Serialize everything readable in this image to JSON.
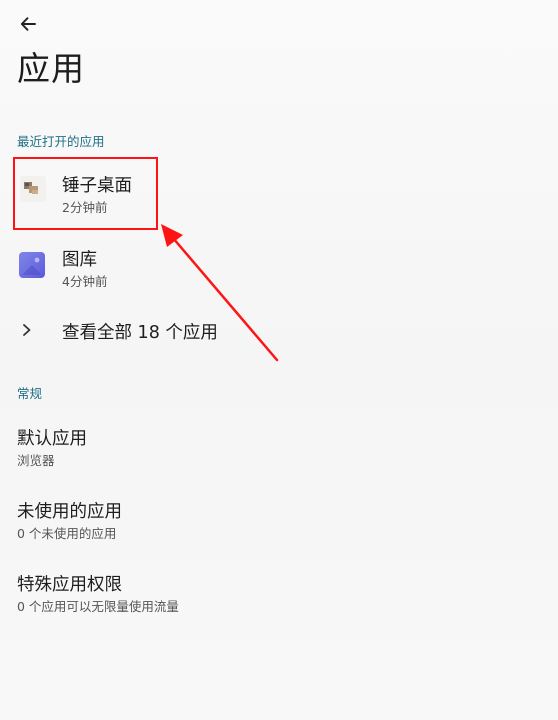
{
  "header": {
    "back_icon": "arrow-left-icon",
    "title": "应用"
  },
  "recent": {
    "header": "最近打开的应用",
    "apps": [
      {
        "name": "锤子桌面",
        "time": "2分钟前",
        "icon": "hammer-launcher-icon"
      },
      {
        "name": "图库",
        "time": "4分钟前",
        "icon": "gallery-icon"
      }
    ],
    "view_all": "查看全部 18 个应用",
    "view_all_icon": "chevron-right-icon"
  },
  "general": {
    "header": "常规",
    "items": [
      {
        "title": "默认应用",
        "subtitle": "浏览器"
      },
      {
        "title": "未使用的应用",
        "subtitle": "0 个未使用的应用"
      },
      {
        "title": "特殊应用权限",
        "subtitle": "0 个应用可以无限量使用流量"
      }
    ]
  },
  "colors": {
    "section_header": "#1f6f86",
    "annotation": "#ff1414",
    "gallery_icon": "#6d6fe0"
  }
}
